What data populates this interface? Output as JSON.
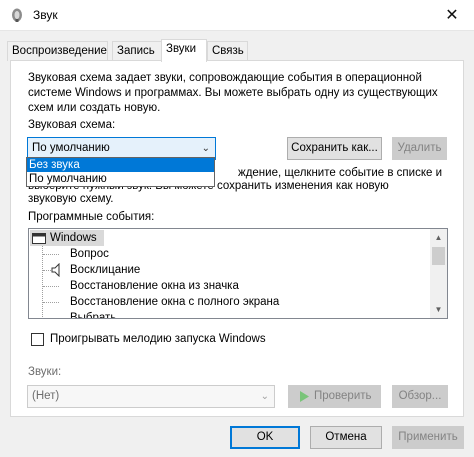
{
  "window": {
    "title": "Звук",
    "close_glyph": "✕",
    "icon": "speaker-icon"
  },
  "tabs": [
    {
      "label": "Воспроизведение"
    },
    {
      "label": "Запись"
    },
    {
      "label": "Звуки",
      "active": true
    },
    {
      "label": "Связь"
    }
  ],
  "description": "Звуковая схема задает звуки, сопровождающие события в операционной системе Windows и программах. Вы можете выбрать одну из существующих схем или создать новую.",
  "scheme": {
    "label": "Звуковая схема:",
    "value": "По умолчанию",
    "save_button": "Сохранить как...",
    "delete_button": "Удалить",
    "options": [
      "Без звука",
      "По умолчанию"
    ],
    "highlighted_option": "Без звука"
  },
  "hint_line1": "ждение, щелкните событие в списке и",
  "hint_line2": "выберите нужный звук. Вы можете сохранить изменения как новую",
  "hint_line3": "звуковую схему.",
  "events": {
    "label": "Программные события:",
    "root": "Windows",
    "items": [
      {
        "label": "Вопрос",
        "has_sound_icon": false
      },
      {
        "label": "Восклицание",
        "has_sound_icon": true
      },
      {
        "label": "Восстановление окна из значка",
        "has_sound_icon": false
      },
      {
        "label": "Восстановление окна с полного экрана",
        "has_sound_icon": false
      },
      {
        "label": "Выбрать",
        "has_sound_icon": false
      }
    ]
  },
  "startup_checkbox": {
    "label": "Проигрывать мелодию запуска Windows",
    "checked": false
  },
  "sounds": {
    "label": "Звуки:",
    "value": "(Нет)",
    "test_button": "Проверить",
    "browse_button": "Обзор..."
  },
  "footer": {
    "ok": "OK",
    "cancel": "Отмена",
    "apply": "Применить"
  },
  "colors": {
    "accent": "#0078d7",
    "selection_bg": "#e5f1fb",
    "test_icon": "#7ac47a"
  }
}
